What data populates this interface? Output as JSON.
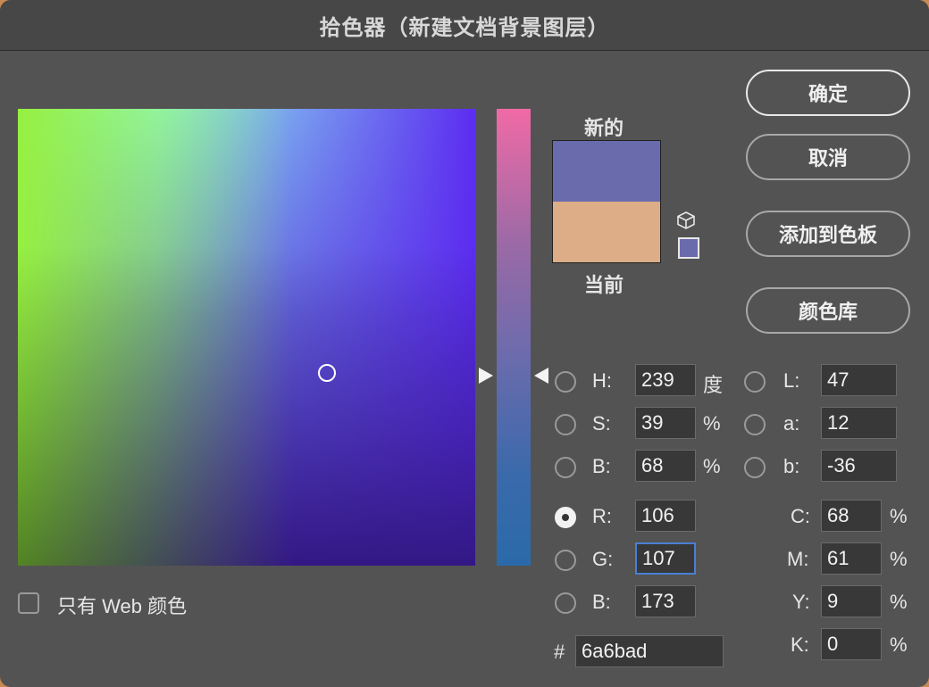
{
  "title": "拾色器（新建文档背景图层）",
  "preview": {
    "new_label": "新的",
    "current_label": "当前",
    "new_color": "#6a6bad",
    "current_color": "#dcad86"
  },
  "field_cursor": "circle",
  "buttons": {
    "ok": "确定",
    "cancel": "取消",
    "add_to_swatches": "添加到色板",
    "color_libraries": "颜色库"
  },
  "hsb": {
    "h": {
      "label": "H:",
      "value": "239",
      "unit": "度"
    },
    "s": {
      "label": "S:",
      "value": "39",
      "unit": "%"
    },
    "b": {
      "label": "B:",
      "value": "68",
      "unit": "%"
    }
  },
  "lab": {
    "l": {
      "label": "L:",
      "value": "47"
    },
    "a": {
      "label": "a:",
      "value": "12"
    },
    "b": {
      "label": "b:",
      "value": "-36"
    }
  },
  "rgb": {
    "r": {
      "label": "R:",
      "value": "106"
    },
    "g": {
      "label": "G:",
      "value": "107"
    },
    "b": {
      "label": "B:",
      "value": "173"
    }
  },
  "cmyk": {
    "c": {
      "label": "C:",
      "value": "68",
      "unit": "%"
    },
    "m": {
      "label": "M:",
      "value": "61",
      "unit": "%"
    },
    "y": {
      "label": "Y:",
      "value": "9",
      "unit": "%"
    },
    "k": {
      "label": "K:",
      "value": "0",
      "unit": "%"
    }
  },
  "hex": {
    "label": "#",
    "value": "6a6bad"
  },
  "web_only": {
    "label": "只有 Web 颜色",
    "checked": false
  },
  "selected_channel": "R",
  "icons": {
    "out_of_gamut": "cube-icon",
    "web_safe": "websafe-swatch"
  }
}
